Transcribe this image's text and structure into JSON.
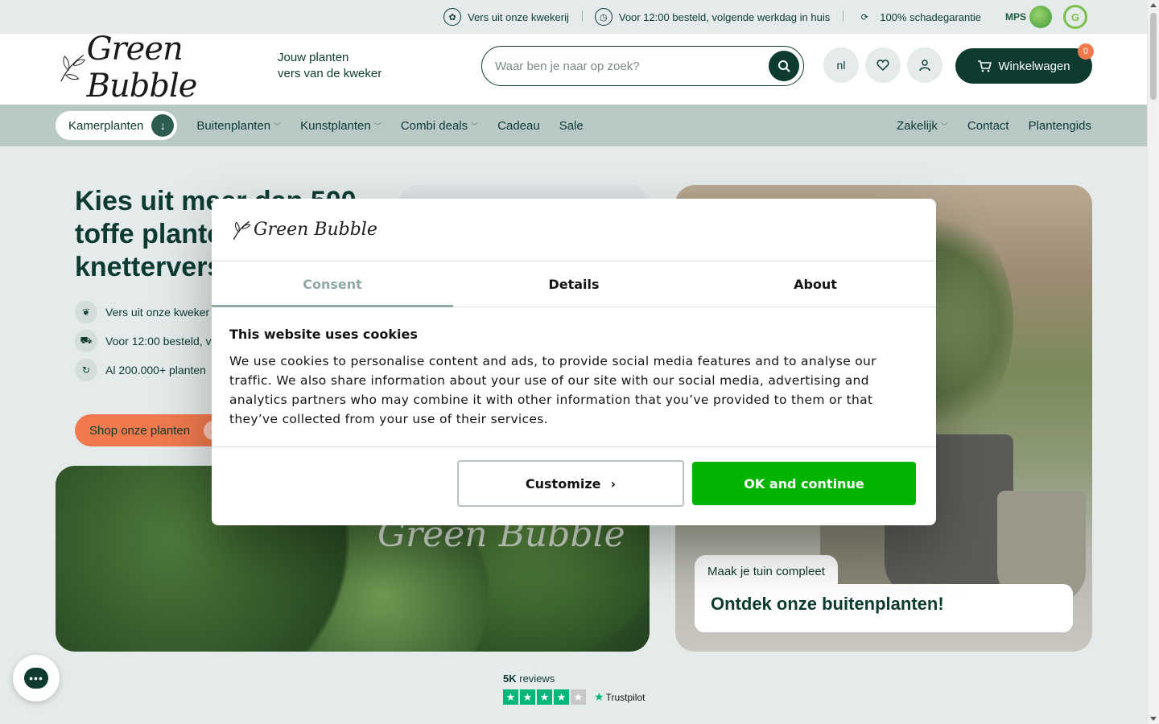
{
  "usp_bar": {
    "items": [
      {
        "icon": "leaf-badge-icon",
        "label": "Vers uit onze kwekerij"
      },
      {
        "icon": "clock-box-icon",
        "label": "Voor 12:00 besteld, volgende werkdag in huis"
      },
      {
        "icon": "shield-return-icon",
        "label": "100% schadegarantie"
      }
    ],
    "certs": {
      "mps": "MPS",
      "globalgap": "G"
    }
  },
  "header": {
    "logo": "Green Bubble",
    "tagline_line1": "Jouw planten",
    "tagline_line2": "vers van de kweker",
    "search_placeholder": "Waar ben je naar op zoek?",
    "language": "nl",
    "cart_label": "Winkelwagen",
    "cart_count": "0"
  },
  "nav": {
    "main": [
      {
        "label": "Kamerplanten",
        "active": true
      },
      {
        "label": "Buitenplanten",
        "dropdown": true
      },
      {
        "label": "Kunstplanten",
        "dropdown": true
      },
      {
        "label": "Combi deals",
        "dropdown": true
      },
      {
        "label": "Cadeau",
        "dropdown": false
      },
      {
        "label": "Sale",
        "dropdown": false
      }
    ],
    "right": [
      {
        "label": "Zakelijk",
        "dropdown": true
      },
      {
        "label": "Contact",
        "dropdown": false
      },
      {
        "label": "Plantengids",
        "dropdown": false
      }
    ]
  },
  "hero": {
    "title_visible": "Kies uit meer dan 500 toffe planten knettervers",
    "usps": [
      {
        "icon": "sprout-icon",
        "label": "Vers uit onze kweker"
      },
      {
        "icon": "truck-icon",
        "label": "Voor 12:00 besteld, v"
      },
      {
        "icon": "refresh-icon",
        "label": "Al 200.000+ planten"
      }
    ],
    "cta": "Shop onze planten",
    "watermark": "Green Bubble"
  },
  "promo": {
    "tag": "Maak je tuin compleet",
    "title": "Ontdek onze buitenplanten!"
  },
  "reviews": {
    "count": "5K",
    "label": "reviews",
    "stars_filled": 4,
    "stars_total": 5,
    "provider": "Trustpilot"
  },
  "cookie_dialog": {
    "logo": "Green Bubble",
    "tabs": [
      {
        "label": "Consent",
        "active": true
      },
      {
        "label": "Details",
        "active": false
      },
      {
        "label": "About",
        "active": false
      }
    ],
    "title": "This website uses cookies",
    "body": "We use cookies to personalise content and ads, to provide social media features and to analyse our traffic. We also share information about your use of our site with our social media, advertising and analytics partners who may combine it with other information that you’ve provided to them or that they’ve collected from your use of their services.",
    "customize_label": "Customize",
    "ok_label": "OK and continue"
  },
  "colors": {
    "brand_dark": "#0d3b30",
    "accent_orange": "#f07a4d",
    "ok_green": "#00b400",
    "trustpilot_green": "#00b67a"
  }
}
